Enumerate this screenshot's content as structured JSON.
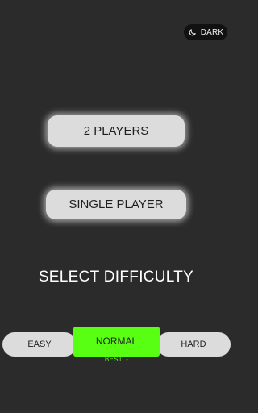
{
  "theme_toggle": {
    "icon": "moon-icon",
    "label": "DARK"
  },
  "menu": {
    "two_players_label": "2 PLAYERS",
    "single_player_label": "SINGLE PLAYER"
  },
  "difficulty": {
    "title": "SELECT DIFFICULTY",
    "options": [
      "EASY",
      "NORMAL",
      "HARD"
    ],
    "selected": "NORMAL",
    "best_label": "BEST: -"
  },
  "colors": {
    "background": "#2b2b2b",
    "button": "#dcdcdc",
    "accent": "#58ff12"
  }
}
